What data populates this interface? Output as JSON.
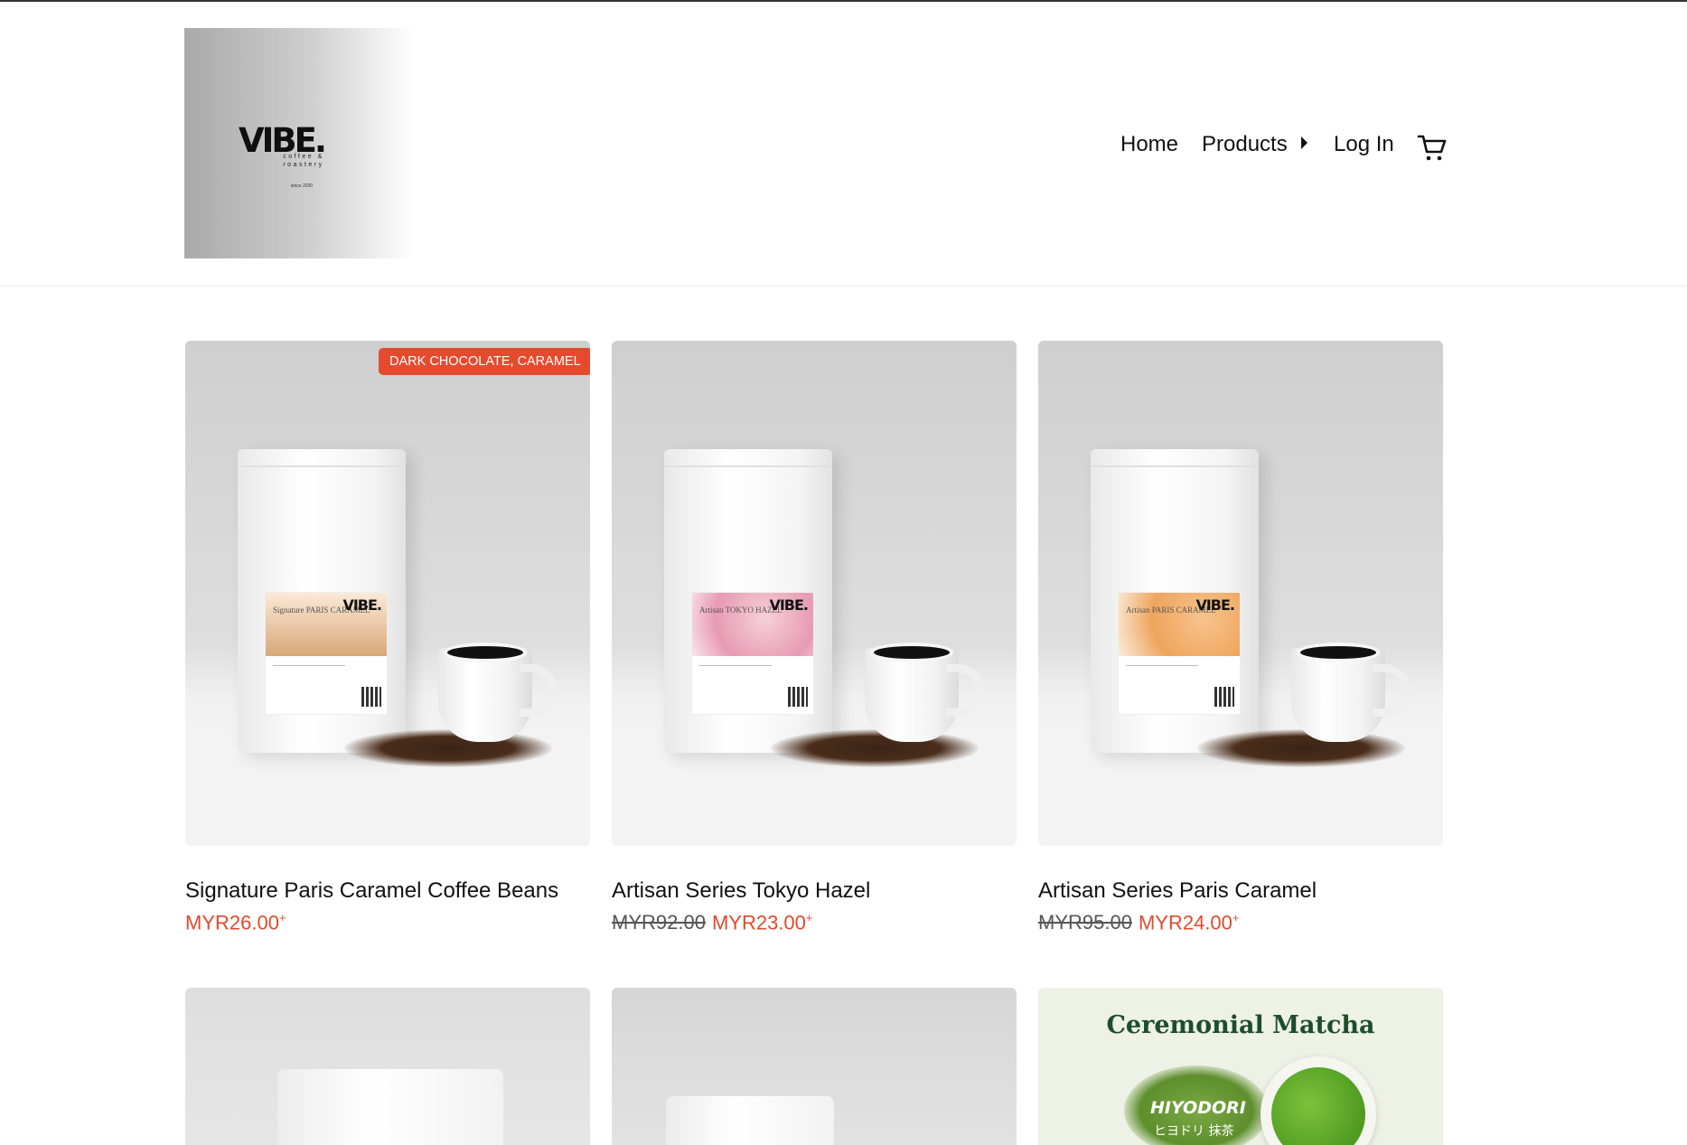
{
  "header": {
    "logo": {
      "brand": "VIBE.",
      "tagline": "coffee & roastery",
      "since": "since 2020"
    },
    "nav": {
      "home": "Home",
      "products": "Products",
      "login": "Log In"
    }
  },
  "products": [
    {
      "badge": "DARK CHOCOLATE, CARAMEL",
      "title": "Signature Paris Caramel Coffee Beans",
      "old_price": "",
      "price": "MYR26.00",
      "price_suffix": "+",
      "label_name": "Signature PARIS CARAMEL",
      "label_brand": "VIBE.",
      "art_color": "#d8a877"
    },
    {
      "badge": "",
      "title": "Artisan Series Tokyo Hazel",
      "old_price": "MYR92.00",
      "price": "MYR23.00",
      "price_suffix": "+",
      "label_name": "Artisan TOKYO HAZEL",
      "label_brand": "VIBE.",
      "art_color": "#f0b8c8"
    },
    {
      "badge": "",
      "title": "Artisan Series Paris Caramel",
      "old_price": "MYR95.00",
      "price": "MYR24.00",
      "price_suffix": "+",
      "label_name": "Artisan PARIS CARAMEL",
      "label_brand": "VIBE.",
      "art_color": "#f3b77a"
    }
  ],
  "second_row": {
    "matcha_title": "Ceremonial Matcha",
    "matcha_brand": "HIYODORI",
    "matcha_jp": "ヒヨドリ 抹茶"
  },
  "colors": {
    "accent": "#e64a2e",
    "price": "#e04a2c"
  },
  "icons": {
    "cart": "cart-icon",
    "submenu": "caret-right-icon"
  }
}
